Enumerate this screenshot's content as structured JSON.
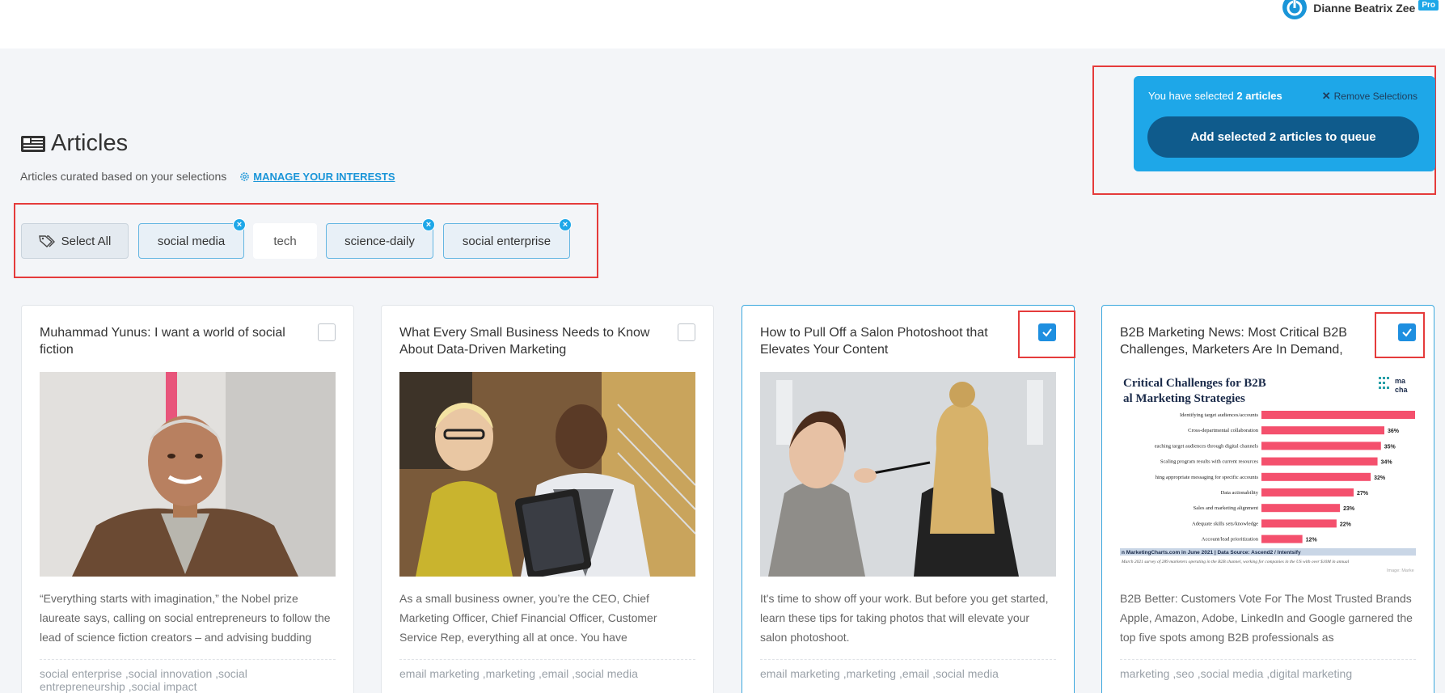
{
  "user": {
    "name": "Dianne Beatrix Zee",
    "badge": "Pro"
  },
  "selection": {
    "prefix": "You have selected ",
    "count_text": "2 articles",
    "remove_label": "Remove Selections",
    "add_label": "Add selected 2 articles to queue"
  },
  "header": {
    "title": "Articles",
    "subtitle": "Articles curated based on your selections",
    "manage_label": "MANAGE YOUR INTERESTS"
  },
  "filters": {
    "select_all": "Select All",
    "chips": [
      "social media",
      "tech",
      "science-daily",
      "social enterprise"
    ]
  },
  "articles": [
    {
      "title": "Muhammad Yunus: I want a world of social fiction",
      "description": "“Everything starts with imagination,” the Nobel prize laureate says, calling on social entrepreneurs to follow the lead of science fiction creators – and advising budding",
      "tags": "social enterprise ,social innovation ,social entrepreneurship ,social impact",
      "selected": false
    },
    {
      "title": "What Every Small Business Needs to Know About Data-Driven Marketing",
      "description": "As a small business owner, you’re the CEO, Chief Marketing Officer, Chief Financial Officer, Customer Service Rep, everything all at once. You have",
      "tags": "email marketing ,marketing ,email ,social media",
      "selected": false
    },
    {
      "title": "How to Pull Off a Salon Photoshoot that Elevates Your Content",
      "description": "It's time to show off your work. But before you get started, learn these tips for taking photos that will elevate your salon photoshoot.",
      "tags": "email marketing ,marketing ,email ,social media",
      "selected": true
    },
    {
      "title": "B2B Marketing News: Most Critical B2B Challenges, Marketers Are In Demand,",
      "description": "B2B Better: Customers Vote For The Most Trusted Brands Apple, Amazon, Adobe, LinkedIn and Google garnered the top five spots among B2B professionals as",
      "tags": "marketing ,seo ,social media ,digital marketing",
      "selected": true
    }
  ],
  "infographic": {
    "title_line1": "Critical Challenges for B2B",
    "title_line2": "al Marketing Strategies",
    "logo": "ma cha",
    "rows": [
      {
        "label": "Identifying target audiences/accounts",
        "value": 45,
        "value_label": ""
      },
      {
        "label": "Cross-departmental collaboration",
        "value": 36,
        "value_label": "36%"
      },
      {
        "label": "eaching target audiences through digital channels",
        "value": 35,
        "value_label": "35%"
      },
      {
        "label": "Scaling program results with current resources",
        "value": 34,
        "value_label": "34%"
      },
      {
        "label": "hing appropriate messaging for specific accounts",
        "value": 32,
        "value_label": "32%"
      },
      {
        "label": "Data actionability",
        "value": 27,
        "value_label": "27%"
      },
      {
        "label": "Sales and marketing alignment",
        "value": 23,
        "value_label": "23%"
      },
      {
        "label": "Adequate skills sets/knowledge",
        "value": 22,
        "value_label": "22%"
      },
      {
        "label": "Account/lead prioritization",
        "value": 12,
        "value_label": "12%"
      }
    ],
    "source": "n MarketingCharts.com in June 2021 | Data Source: Ascend2 / Intentsify",
    "footnote": "March 2021 survey of 289 marketers operating in the B2B channel, working for companies in the US with over $10M in annual",
    "credit": "Image: Marke"
  },
  "colors": {
    "accent": "#1ea7e8",
    "accent_dark": "#0f5b8c",
    "highlight": "#e53b3b",
    "bar": "#f4506d"
  }
}
